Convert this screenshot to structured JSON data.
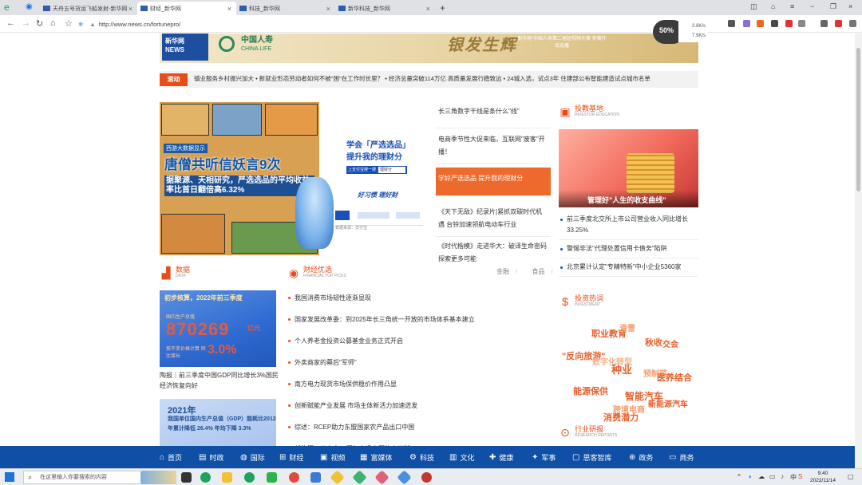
{
  "tabs": [
    {
      "title": "天舟五号货运飞船发射-新华网",
      "active": false
    },
    {
      "title": "财经_新华网",
      "active": true
    },
    {
      "title": "科技_新华网",
      "active": false
    },
    {
      "title": "新华科技_新华网",
      "active": false
    }
  ],
  "address": {
    "url": "http://www.news.cn/fortunepro/"
  },
  "netmon": {
    "percent": "50%",
    "up": "3.8K/s",
    "down": "7.9K/s"
  },
  "banner": {
    "xinhua_logo": "新华网 NEWS",
    "brand_cn": "中国人寿",
    "brand_en": "CHINA LIFE",
    "slogan": "银发生辉",
    "note": "新华网 中国人寿第二届短视频大赛 参赛作品选播"
  },
  "ticker": {
    "tag": "滚动",
    "text": "镇业服务乡村振兴加大 • 新就业形态劳动者如何不被\"困\"在工作时长里？ • 经济总量突破114万亿 高质量发展行稳致远 • 24城入选，试点3年 住建部公布智能建造试点城市名单"
  },
  "hero": {
    "tag": "西游大数据显示",
    "title": "唐僧共听信妖言9次",
    "subtitle": "据聚源、天相研究，严选选品的平均收益率比首日翻倍高6.32%",
    "sale_title1": "学会「严选选品」",
    "sale_title2": "提升我的理财分",
    "sale_input_label": "上支付宝搜一搜",
    "sale_input_value": "理财分",
    "sale_cta": "好习惯  理好财",
    "sale_small": "数据来源：支付宝"
  },
  "mid_headlines": [
    {
      "text": "长三角数字干线是条什么\"线\"",
      "highlight": false
    },
    {
      "text": "电商季节性大促来临，互联网\"废客\"开播！",
      "highlight": false
    },
    {
      "text": "学好严选选品 提升我的理财分",
      "highlight": true
    },
    {
      "text": "《天下无敌》纪录片|紧抓双碳时代机遇 台铃加速领航电动车行业",
      "highlight": false
    },
    {
      "text": "《时代楷模》走进华大：破译生命密码 探索更多可能",
      "highlight": false
    }
  ],
  "invest": {
    "title": "投教基地",
    "subtitle": "INVESTOR EDUCATION",
    "image_caption": "管理好\"人生的收支曲线\"",
    "items": [
      "前三季度北交所上市公司营业收入同比增长33.25%",
      "警惕非法\"代理处置信用卡债务\"陷阱",
      "北京累计认定\"专精特新\"中小企业5360家"
    ]
  },
  "data_section": {
    "title": "数据",
    "subtitle": "DATA",
    "card1_title": "初步核算，2022年前三季度",
    "card1_label": "国内生产总值",
    "card1_value": "870269",
    "card1_unit": "亿元",
    "card1_growth_label": "按不变价格计算 同比增长",
    "card1_growth": "3.0%",
    "caption": "陶报｜前三季度中国GDP同比增长3%国民经济恢复向好",
    "card2_year": "2021年",
    "card2_desc": "我国单位国内生产总值（GDP）能耗比2012年累计降低 26.4%  年均下降 3.3%"
  },
  "finance": {
    "title": "财经优选",
    "subtitle": "FINANCIAL TOP PICKS",
    "filters": [
      "金融",
      "食品"
    ],
    "items": [
      "我国消费市场韧性逐渐显现",
      "国家发展改革委：到2025年长三角统一开放的市场体系基本建立",
      "个人养老金投资公募基金业务正式开启",
      "外卖商家的幕后\"军师\"",
      "南方电力现货市场保供稳价作用凸显",
      "创新赋能产业发展 市场主体新活力加速迸发",
      "综述：RCEP助力东盟国家农产品出口中国",
      "新能源、元宇宙... 开年市场主题热点不断"
    ]
  },
  "hot_invest": {
    "title": "投资热词",
    "subtitle": "INVESTMENT",
    "words": [
      "职业教育",
      "滑雪",
      "秋收",
      "交会",
      "\"反向旅游\"",
      "数字化转型",
      "种业",
      "预制菜",
      "医养结合",
      "能源保供",
      "智能汽车",
      "新能源汽车",
      "跨境电商",
      "消费潜力"
    ]
  },
  "research": {
    "title": "行业研报",
    "subtitle": "RESEARCH REPORTS"
  },
  "bottom_nav": [
    "首页",
    "时政",
    "国际",
    "财经",
    "视频",
    "富媒体",
    "科技",
    "文化",
    "健康",
    "军事",
    "思客智库",
    "政务",
    "商务"
  ],
  "taskbar": {
    "search_placeholder": "在这里输入你要搜索的内容",
    "ime": "中",
    "time": "9:40",
    "date": "2022/11/14"
  }
}
